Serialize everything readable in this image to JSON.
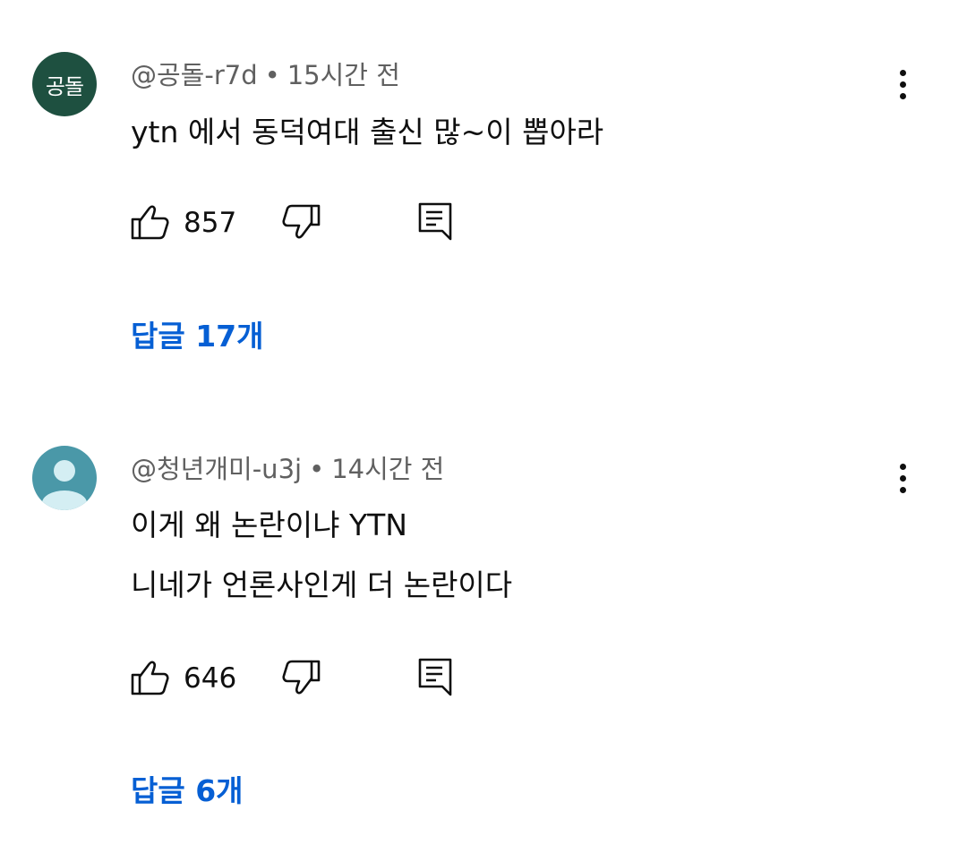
{
  "comments": [
    {
      "avatar_initials": "공돌",
      "avatar_color": "#1e5040",
      "author": "@공돌-r7d",
      "separator": "•",
      "time": "15시간 전",
      "lines": [
        "ytn 에서 동덕여대 출신 많~이 뽑아라"
      ],
      "likes": "857",
      "replies": "답글 17개"
    },
    {
      "avatar_initials": "",
      "avatar_color": "#4a98a8",
      "author": "@청년개미-u3j",
      "separator": "•",
      "time": "14시간 전",
      "lines": [
        "이게 왜 논란이냐 YTN",
        "니네가 언론사인게 더 논란이다"
      ],
      "likes": "646",
      "replies": "답글 6개"
    }
  ],
  "icons": {
    "like": "thumb-up-icon",
    "dislike": "thumb-down-icon",
    "reply": "comment-icon",
    "more": "more-vert-icon"
  },
  "colors": {
    "replies_link": "#065fd4",
    "meta_text": "#606060"
  }
}
